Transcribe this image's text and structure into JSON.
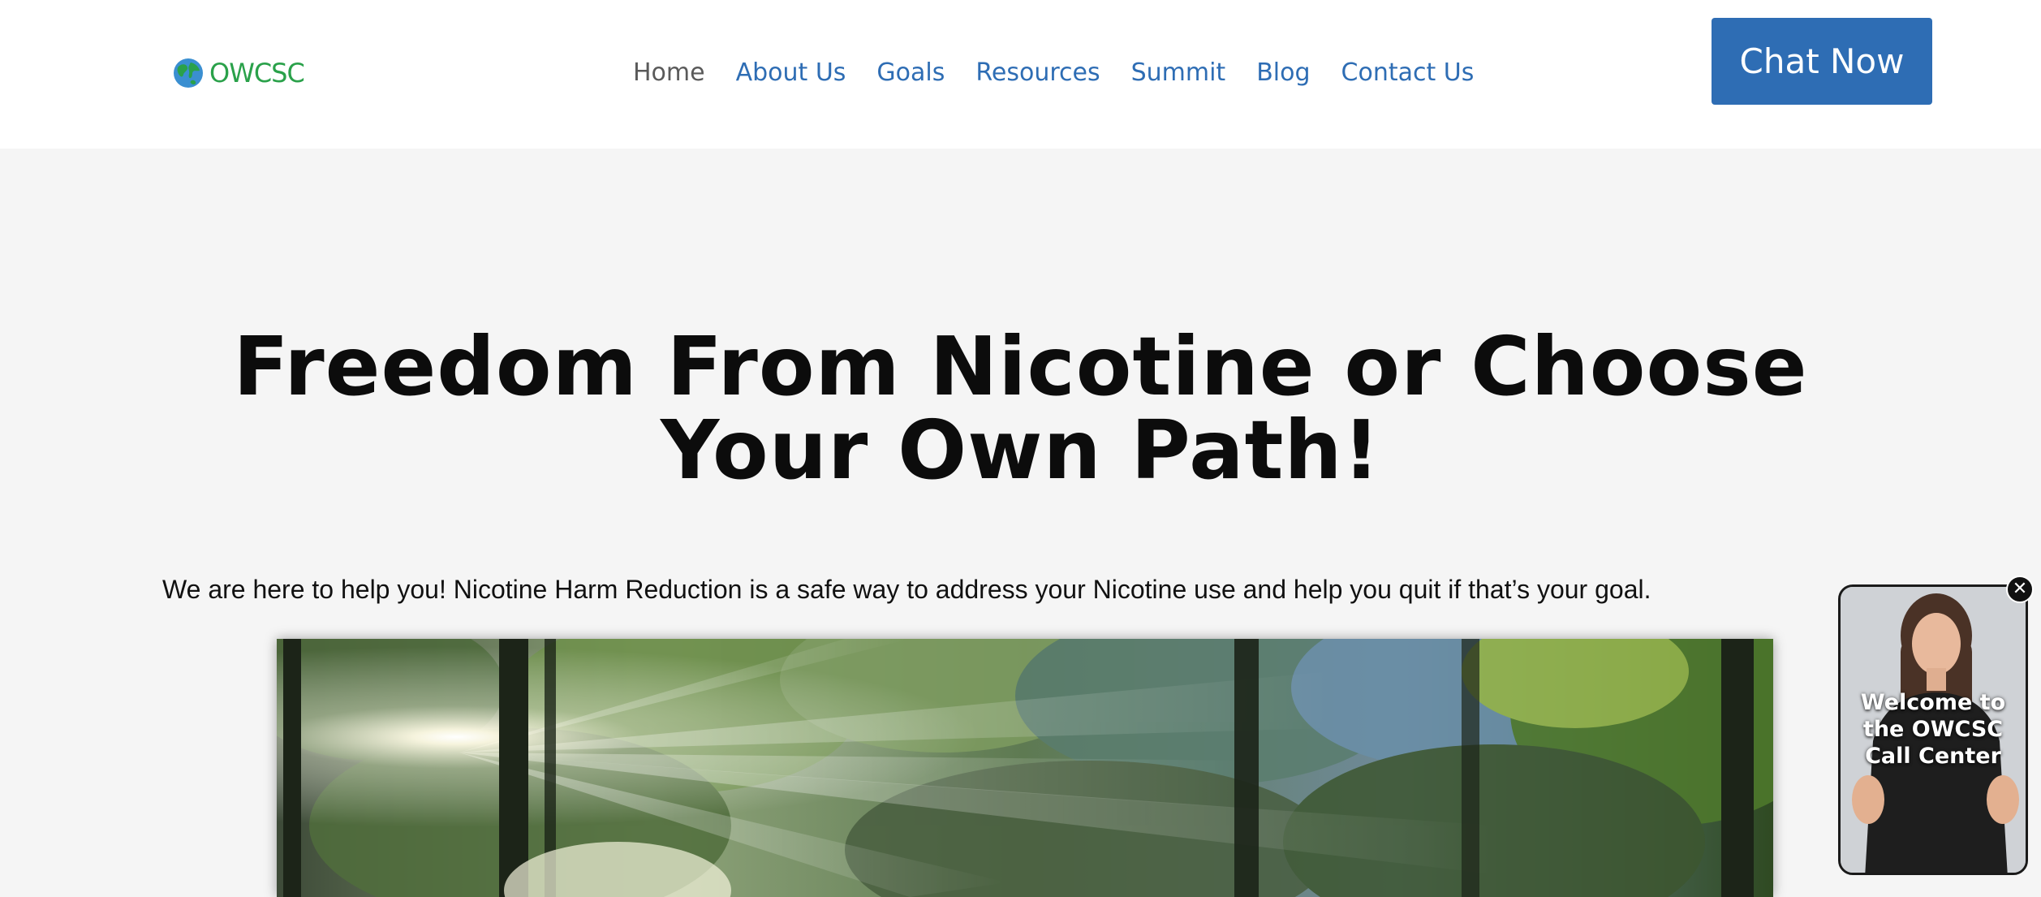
{
  "header": {
    "logo_text": "OWCSC",
    "logo_color": "#2aa14a",
    "nav": [
      {
        "label": "Home",
        "active": true
      },
      {
        "label": "About Us",
        "active": false
      },
      {
        "label": "Goals",
        "active": false
      },
      {
        "label": "Resources",
        "active": false
      },
      {
        "label": "Summit",
        "active": false
      },
      {
        "label": "Blog",
        "active": false
      },
      {
        "label": "Contact Us",
        "active": false
      }
    ],
    "cta_label": "Chat Now",
    "accent_color": "#2e6db4"
  },
  "hero": {
    "title_line1": "Freedom From Nicotine or Choose",
    "title_line2": "Your Own Path!",
    "subtitle": "We are here to help you! Nicotine Harm Reduction is a safe way to address your Nicotine use and help you quit if that’s your goal.",
    "image_subject": "sunlit forest"
  },
  "video_widget": {
    "caption_line1": "Welcome to",
    "caption_line2": "the OWCSC",
    "caption_line3": "Call Center",
    "close_icon": "close-icon"
  }
}
